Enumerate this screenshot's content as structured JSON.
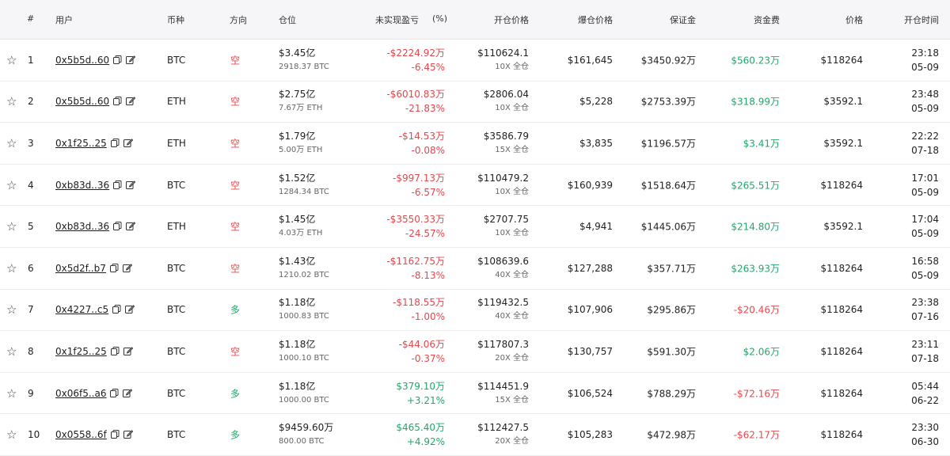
{
  "headers": {
    "index": "#",
    "user": "用户",
    "coin": "币种",
    "direction": "方向",
    "position": "仓位",
    "pnl": "未实现盈亏",
    "pnl_pct": "(%)",
    "entry_price": "开仓价格",
    "liq_price": "爆仓价格",
    "margin": "保证金",
    "funding": "资金费",
    "price": "价格",
    "open_time": "开仓时间"
  },
  "icons": {
    "favorite": "star-icon",
    "copy": "copy-icon",
    "edit": "edit-icon"
  },
  "colors": {
    "positive": "#20a86b",
    "negative": "#e5484d",
    "header_bg": "#f6f6f8"
  },
  "rows": [
    {
      "idx": "1",
      "user": "0x5b5d..60",
      "coin": "BTC",
      "direction": "空",
      "dir_color": "red",
      "position": "$3.45亿",
      "size": "2918.37 BTC",
      "pnl": "-$2224.92万",
      "pnl_pct": "-6.45%",
      "pnl_color": "red",
      "entry": "$110624.1",
      "leverage": "10X 全仓",
      "liq": "$161,645",
      "margin": "$3450.92万",
      "funding": "$560.23万",
      "funding_color": "green",
      "price": "$118264",
      "time": "23:18",
      "date": "05-09"
    },
    {
      "idx": "2",
      "user": "0x5b5d..60",
      "coin": "ETH",
      "direction": "空",
      "dir_color": "red",
      "position": "$2.75亿",
      "size": "7.67万 ETH",
      "pnl": "-$6010.83万",
      "pnl_pct": "-21.83%",
      "pnl_color": "red",
      "entry": "$2806.04",
      "leverage": "10X 全仓",
      "liq": "$5,228",
      "margin": "$2753.39万",
      "funding": "$318.99万",
      "funding_color": "green",
      "price": "$3592.1",
      "time": "23:48",
      "date": "05-09"
    },
    {
      "idx": "3",
      "user": "0x1f25..25",
      "coin": "ETH",
      "direction": "空",
      "dir_color": "red",
      "position": "$1.79亿",
      "size": "5.00万 ETH",
      "pnl": "-$14.53万",
      "pnl_pct": "-0.08%",
      "pnl_color": "red",
      "entry": "$3586.79",
      "leverage": "15X 全仓",
      "liq": "$3,835",
      "margin": "$1196.57万",
      "funding": "$3.41万",
      "funding_color": "green",
      "price": "$3592.1",
      "time": "22:22",
      "date": "07-18"
    },
    {
      "idx": "4",
      "user": "0xb83d..36",
      "coin": "BTC",
      "direction": "空",
      "dir_color": "red",
      "position": "$1.52亿",
      "size": "1284.34 BTC",
      "pnl": "-$997.13万",
      "pnl_pct": "-6.57%",
      "pnl_color": "red",
      "entry": "$110479.2",
      "leverage": "10X 全仓",
      "liq": "$160,939",
      "margin": "$1518.64万",
      "funding": "$265.51万",
      "funding_color": "green",
      "price": "$118264",
      "time": "17:01",
      "date": "05-09"
    },
    {
      "idx": "5",
      "user": "0xb83d..36",
      "coin": "ETH",
      "direction": "空",
      "dir_color": "red",
      "position": "$1.45亿",
      "size": "4.03万 ETH",
      "pnl": "-$3550.33万",
      "pnl_pct": "-24.57%",
      "pnl_color": "red",
      "entry": "$2707.75",
      "leverage": "10X 全仓",
      "liq": "$4,941",
      "margin": "$1445.06万",
      "funding": "$214.80万",
      "funding_color": "green",
      "price": "$3592.1",
      "time": "17:04",
      "date": "05-09"
    },
    {
      "idx": "6",
      "user": "0x5d2f..b7",
      "coin": "BTC",
      "direction": "空",
      "dir_color": "red",
      "position": "$1.43亿",
      "size": "1210.02 BTC",
      "pnl": "-$1162.75万",
      "pnl_pct": "-8.13%",
      "pnl_color": "red",
      "entry": "$108639.6",
      "leverage": "40X 全仓",
      "liq": "$127,288",
      "margin": "$357.71万",
      "funding": "$263.93万",
      "funding_color": "green",
      "price": "$118264",
      "time": "16:58",
      "date": "05-09"
    },
    {
      "idx": "7",
      "user": "0x4227..c5",
      "coin": "BTC",
      "direction": "多",
      "dir_color": "green",
      "position": "$1.18亿",
      "size": "1000.83 BTC",
      "pnl": "-$118.55万",
      "pnl_pct": "-1.00%",
      "pnl_color": "red",
      "entry": "$119432.5",
      "leverage": "40X 全仓",
      "liq": "$107,906",
      "margin": "$295.86万",
      "funding": "-$20.46万",
      "funding_color": "red",
      "price": "$118264",
      "time": "23:38",
      "date": "07-16"
    },
    {
      "idx": "8",
      "user": "0x1f25..25",
      "coin": "BTC",
      "direction": "空",
      "dir_color": "red",
      "position": "$1.18亿",
      "size": "1000.10 BTC",
      "pnl": "-$44.06万",
      "pnl_pct": "-0.37%",
      "pnl_color": "red",
      "entry": "$117807.3",
      "leverage": "20X 全仓",
      "liq": "$130,757",
      "margin": "$591.30万",
      "funding": "$2.06万",
      "funding_color": "green",
      "price": "$118264",
      "time": "23:11",
      "date": "07-18"
    },
    {
      "idx": "9",
      "user": "0x06f5..a6",
      "coin": "BTC",
      "direction": "多",
      "dir_color": "green",
      "position": "$1.18亿",
      "size": "1000.00 BTC",
      "pnl": "$379.10万",
      "pnl_pct": "+3.21%",
      "pnl_color": "green",
      "entry": "$114451.9",
      "leverage": "15X 全仓",
      "liq": "$106,524",
      "margin": "$788.29万",
      "funding": "-$72.16万",
      "funding_color": "red",
      "price": "$118264",
      "time": "05:44",
      "date": "06-22"
    },
    {
      "idx": "10",
      "user": "0x0558..6f",
      "coin": "BTC",
      "direction": "多",
      "dir_color": "green",
      "position": "$9459.60万",
      "size": "800.00 BTC",
      "pnl": "$465.40万",
      "pnl_pct": "+4.92%",
      "pnl_color": "green",
      "entry": "$112427.5",
      "leverage": "20X 全仓",
      "liq": "$105,283",
      "margin": "$472.98万",
      "funding": "-$62.17万",
      "funding_color": "red",
      "price": "$118264",
      "time": "23:30",
      "date": "06-30"
    }
  ]
}
